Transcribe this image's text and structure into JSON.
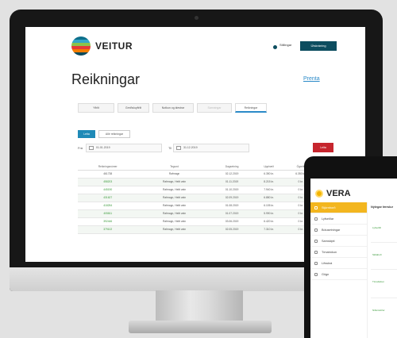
{
  "monitor": {
    "app": {
      "brand": "VEITUR",
      "settings_label": "Stillingar",
      "logout_label": "Útskráning",
      "title": "Reikningar",
      "print_label": "Prenta",
      "tabs": [
        {
          "label": "Yfirlit"
        },
        {
          "label": "Greiðsluyfirlit"
        },
        {
          "label": "Notkun og álestrar"
        },
        {
          "label": "Samningar"
        },
        {
          "label": "Reikningar"
        }
      ],
      "buttons": {
        "primary": "Leita",
        "secondary": "Allir reikningar"
      },
      "from_label": "Frá",
      "from_date": "01.01.2019",
      "to_label": "Til",
      "to_date": "31.12.2019",
      "search_label": "Leita",
      "table": {
        "headers": [
          "Reikningsnúmer",
          "Tegund",
          "Dagsetning",
          "Upphæð",
          "Ógreitt",
          "Velja"
        ],
        "rows": [
          [
            "461738",
            "Rafmagn",
            "02.12.2019",
            "6.350 kr.",
            "6.350 kr.",
            "0"
          ],
          [
            "458203",
            "Rafmagn, Heitt vatn",
            "01.11.2019",
            "8.215 kr.",
            "0 kr.",
            "1"
          ],
          [
            "445190",
            "Rafmagn, Heitt vatn",
            "01.10.2019",
            "7.940 kr.",
            "0 kr.",
            "0"
          ],
          [
            "431627",
            "Rafmagn, Heitt vatn",
            "02.09.2019",
            "6.880 kr.",
            "0 kr.",
            "1"
          ],
          [
            "418254",
            "Rafmagn, Heitt vatn",
            "01.08.2019",
            "6.105 kr.",
            "0 kr.",
            "0"
          ],
          [
            "405811",
            "Rafmagn, Heitt vatn",
            "01.07.2019",
            "5.990 kr.",
            "0 kr.",
            "1"
          ],
          [
            "392446",
            "Rafmagn, Heitt vatn",
            "03.06.2019",
            "6.420 kr.",
            "0 kr.",
            "0"
          ],
          [
            "379102",
            "Rafmagn, Heitt vatn",
            "02.05.2019",
            "7.310 kr.",
            "0 kr.",
            "1"
          ]
        ]
      }
    }
  },
  "tablet": {
    "brand": "VERA",
    "nav": [
      {
        "label": "Stjórnborð"
      },
      {
        "label": "Lyfseðlar"
      },
      {
        "label": "Bólusetningar"
      },
      {
        "label": "Samskipti"
      },
      {
        "label": "Tímabókun"
      },
      {
        "label": "Lífsskrá"
      },
      {
        "label": "Gögn"
      }
    ],
    "header": "Nýlegar færslur",
    "entries": [
      "Lyfseðill",
      "Skilaboð",
      "Tímabókun",
      "Niðurstöður"
    ]
  },
  "colors": {
    "primary": "#0d4d5f",
    "accent": "#2b8ac8",
    "danger": "#c6262e",
    "vera_accent": "#f3b61f"
  }
}
